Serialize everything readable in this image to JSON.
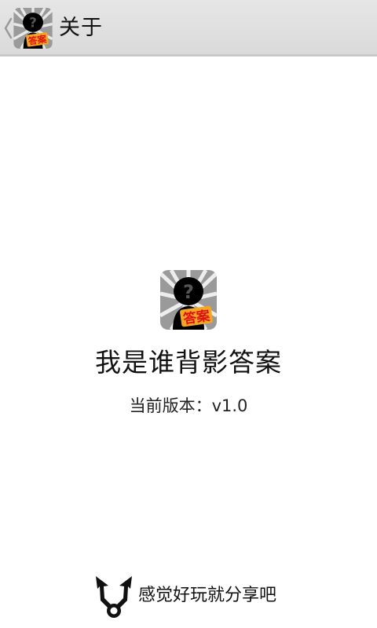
{
  "action_bar": {
    "title": "关于",
    "icon": "app-logo-icon",
    "up_icon": "chevron-left-icon"
  },
  "about": {
    "app_icon": "app-logo-icon",
    "app_name": "我是谁背影答案",
    "version_text": "当前版本：v1.0",
    "logo_badge_text": "答案"
  },
  "share": {
    "icon": "share-icon",
    "label": "感觉好玩就分享吧"
  },
  "colors": {
    "action_bar_bg": "#dcdcdc",
    "badge_fill": "#f5a623",
    "badge_text": "#e01010",
    "silhouette": "#000000"
  }
}
